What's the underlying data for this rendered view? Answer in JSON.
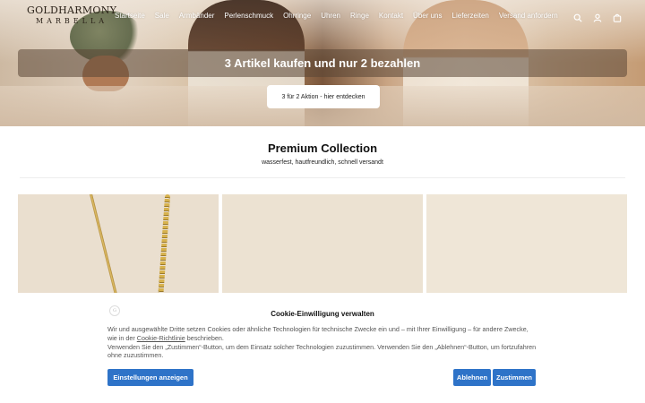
{
  "brand": {
    "line1": "GOLDHARMONY",
    "line2": "MARBELLA"
  },
  "nav": {
    "items": [
      "Startseite",
      "Sale",
      "Armbänder",
      "Perlenschmuck",
      "Ohrringe",
      "Uhren",
      "Ringe",
      "Kontakt",
      "Über uns",
      "Lieferzeiten",
      "Versand anfordern"
    ],
    "icons": [
      "search-icon",
      "account-icon",
      "bag-icon"
    ]
  },
  "hero": {
    "promo_text": "3 Artikel kaufen und nur 2 bezahlen",
    "promo_button": "3 für 2 Aktion - hier entdecken"
  },
  "collection": {
    "title": "Premium Collection",
    "subtitle": "wasserfest, hautfreundlich, schnell versandt"
  },
  "cookie": {
    "title": "Cookie-Einwilligung verwalten",
    "text_1": "Wir und ausgewählte Dritte setzen Cookies oder ähnliche Technologien für technische Zwecke ein und – mit Ihrer Einwilligung – für andere Zwecke, wie in der",
    "link": "Cookie-Richtlinie",
    "text_2": "beschrieben.",
    "text_3": "Verwenden Sie den „Zustimmen“-Button, um dem Einsatz solcher Technologien zuzustimmen. Verwenden Sie den „Ablehnen“-Button, um fortzufahren ohne zuzustimmen.",
    "btn_settings": "Einstellungen anzeigen",
    "btn_reject": "Ablehnen",
    "btn_accept": "Zustimmen"
  },
  "colors": {
    "accent": "#2e73c8"
  }
}
